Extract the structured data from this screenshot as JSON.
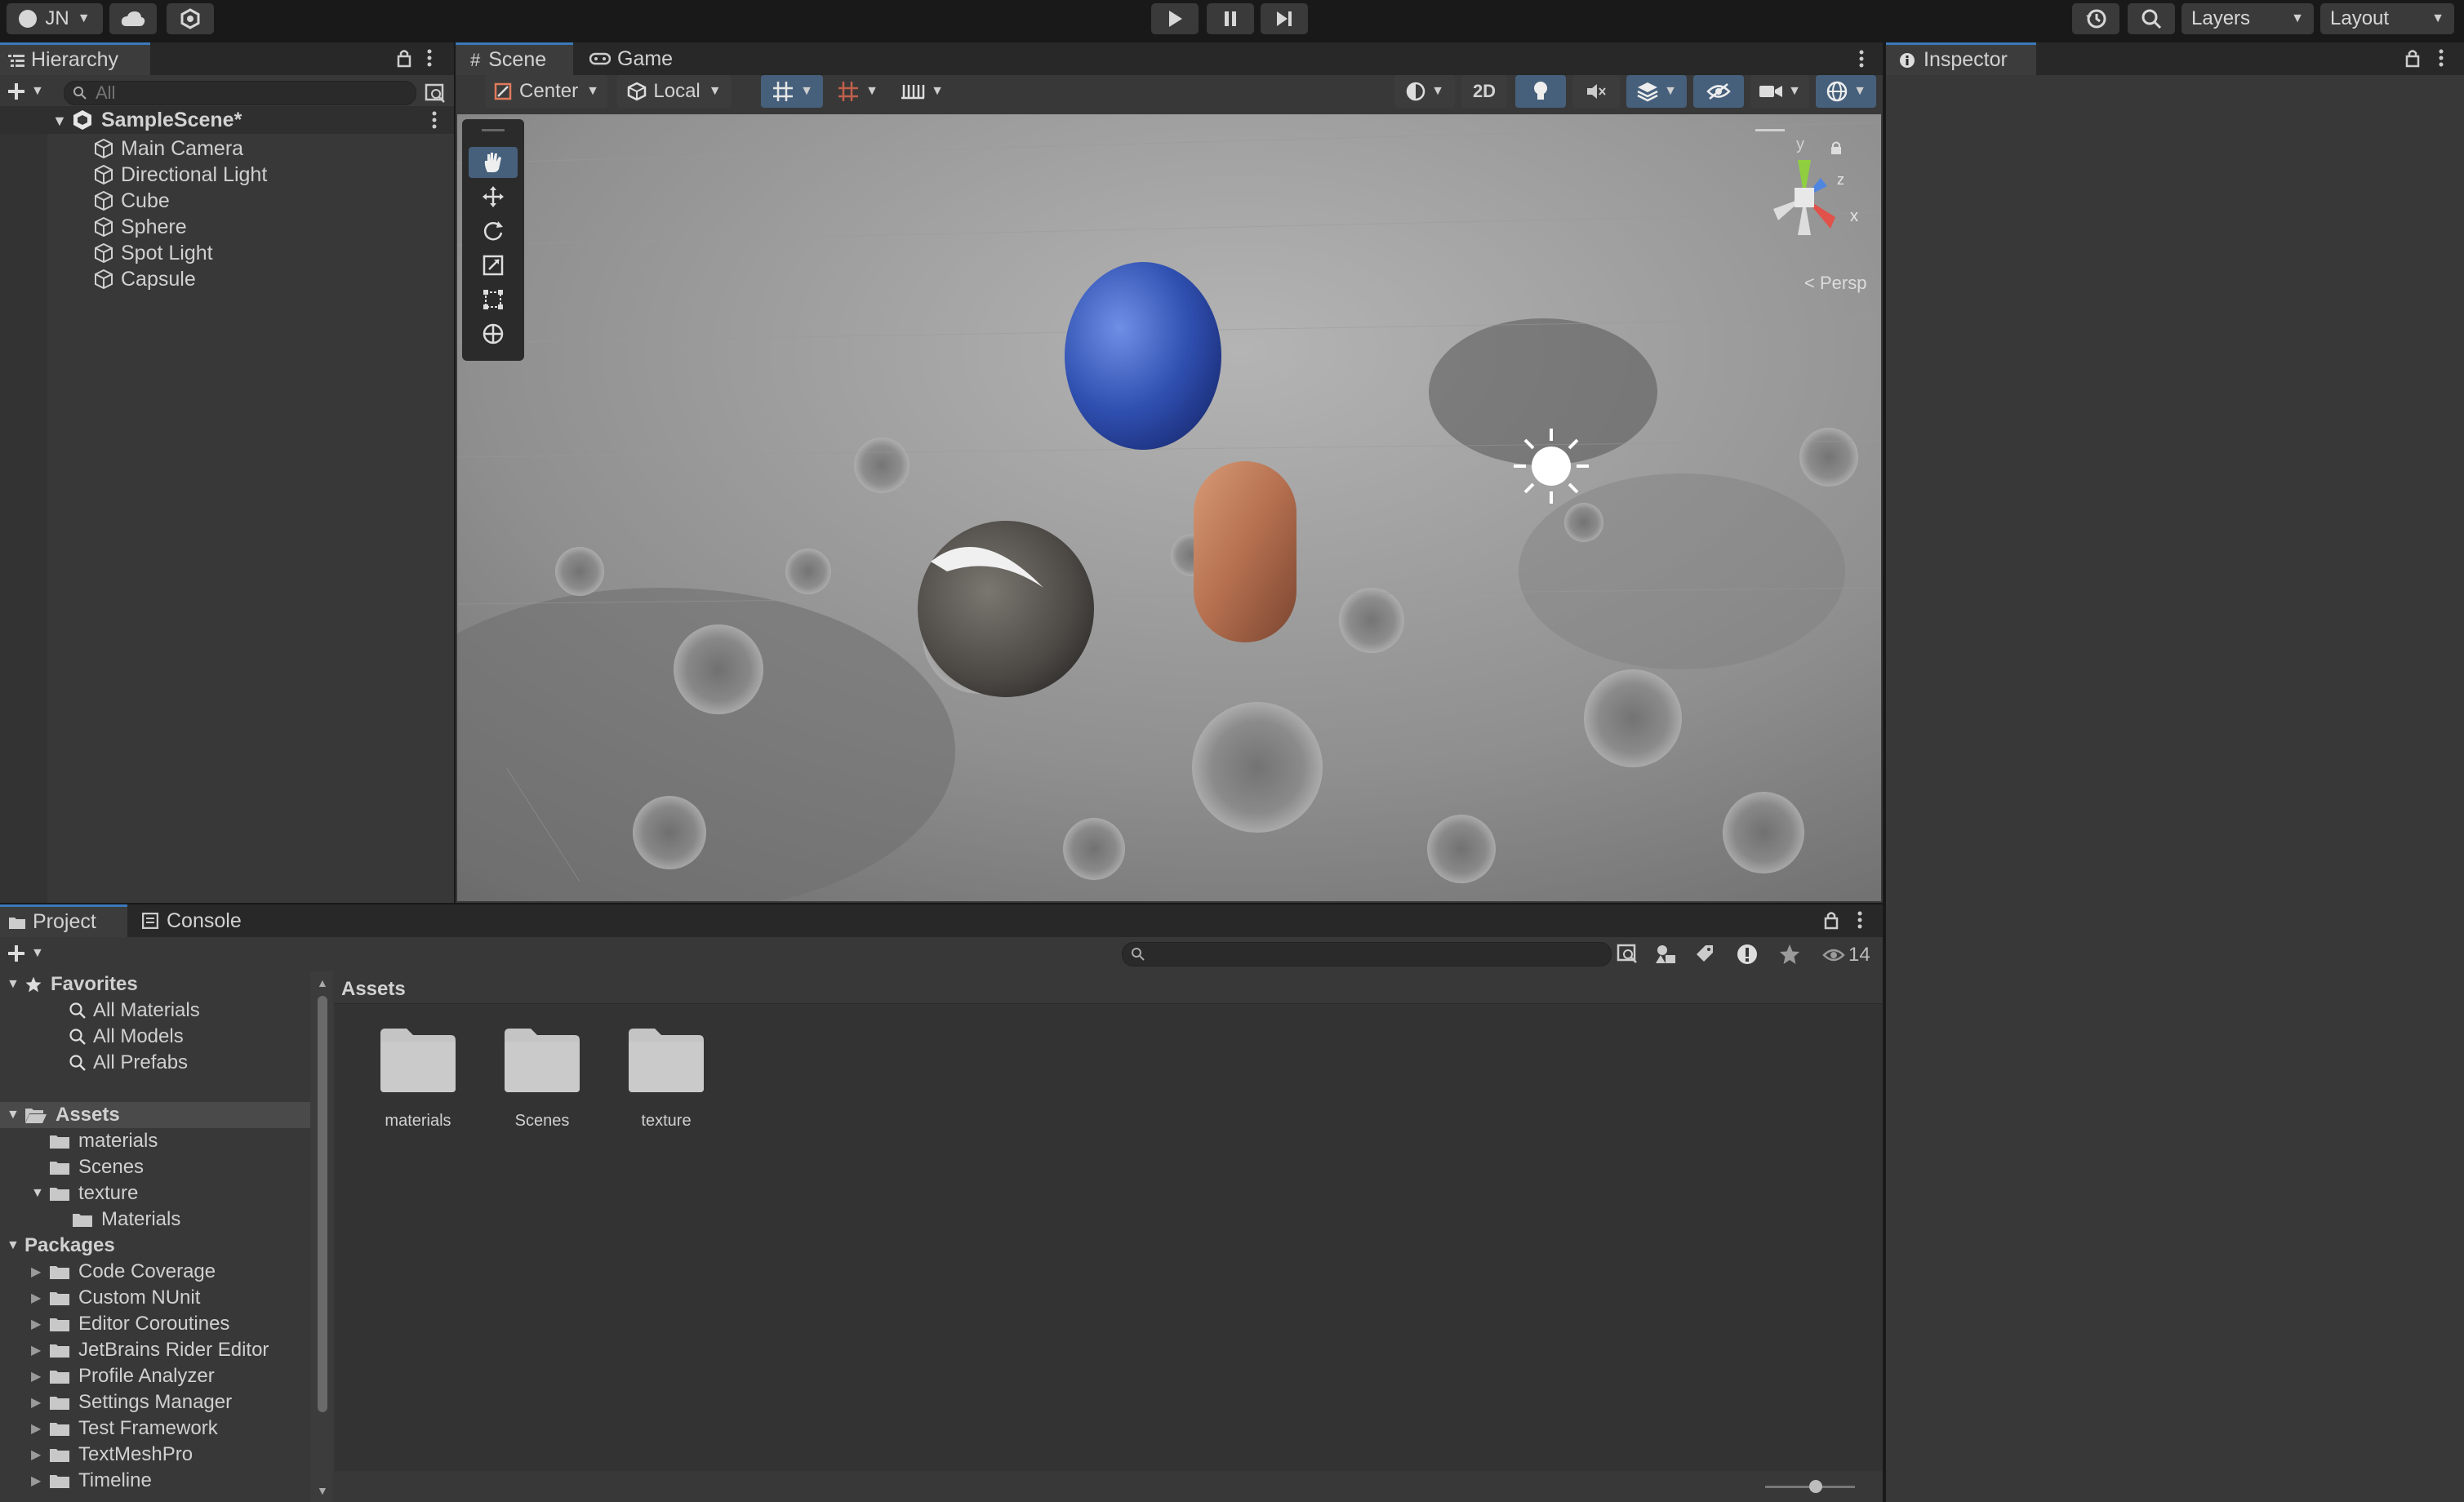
{
  "toolbar": {
    "account_label": "JN",
    "layers_label": "Layers",
    "layout_label": "Layout"
  },
  "hierarchy": {
    "tab_label": "Hierarchy",
    "search_placeholder": "All",
    "scene_name": "SampleScene*",
    "objects": [
      "Main Camera",
      "Directional Light",
      "Cube",
      "Sphere",
      "Spot Light",
      "Capsule"
    ]
  },
  "scene_view": {
    "tabs": [
      "Scene",
      "Game"
    ],
    "pivot_label": "Center",
    "space_label": "Local",
    "mode_2d_label": "2D",
    "persp_label": "< Persp",
    "gizmo_axes": {
      "y": "y",
      "x": "x",
      "z": "z"
    }
  },
  "inspector": {
    "tab_label": "Inspector"
  },
  "project": {
    "tabs": [
      "Project",
      "Console"
    ],
    "hidden_count": "14",
    "breadcrumb": "Assets",
    "favorites": {
      "label": "Favorites",
      "items": [
        "All Materials",
        "All Models",
        "All Prefabs"
      ]
    },
    "assets_tree": {
      "label": "Assets",
      "items": [
        "materials",
        "Scenes",
        "texture"
      ],
      "texture_child": "Materials"
    },
    "packages": {
      "label": "Packages",
      "items": [
        "Code Coverage",
        "Custom NUnit",
        "Editor Coroutines",
        "JetBrains Rider Editor",
        "Profile Analyzer",
        "Settings Manager",
        "Test Framework",
        "TextMeshPro",
        "Timeline"
      ]
    },
    "grid_folders": [
      "materials",
      "Scenes",
      "texture"
    ]
  },
  "colors": {
    "accent": "#3a79bb",
    "panel_bg": "#383838",
    "header_bg": "#282828",
    "text": "#d2d2d2"
  }
}
